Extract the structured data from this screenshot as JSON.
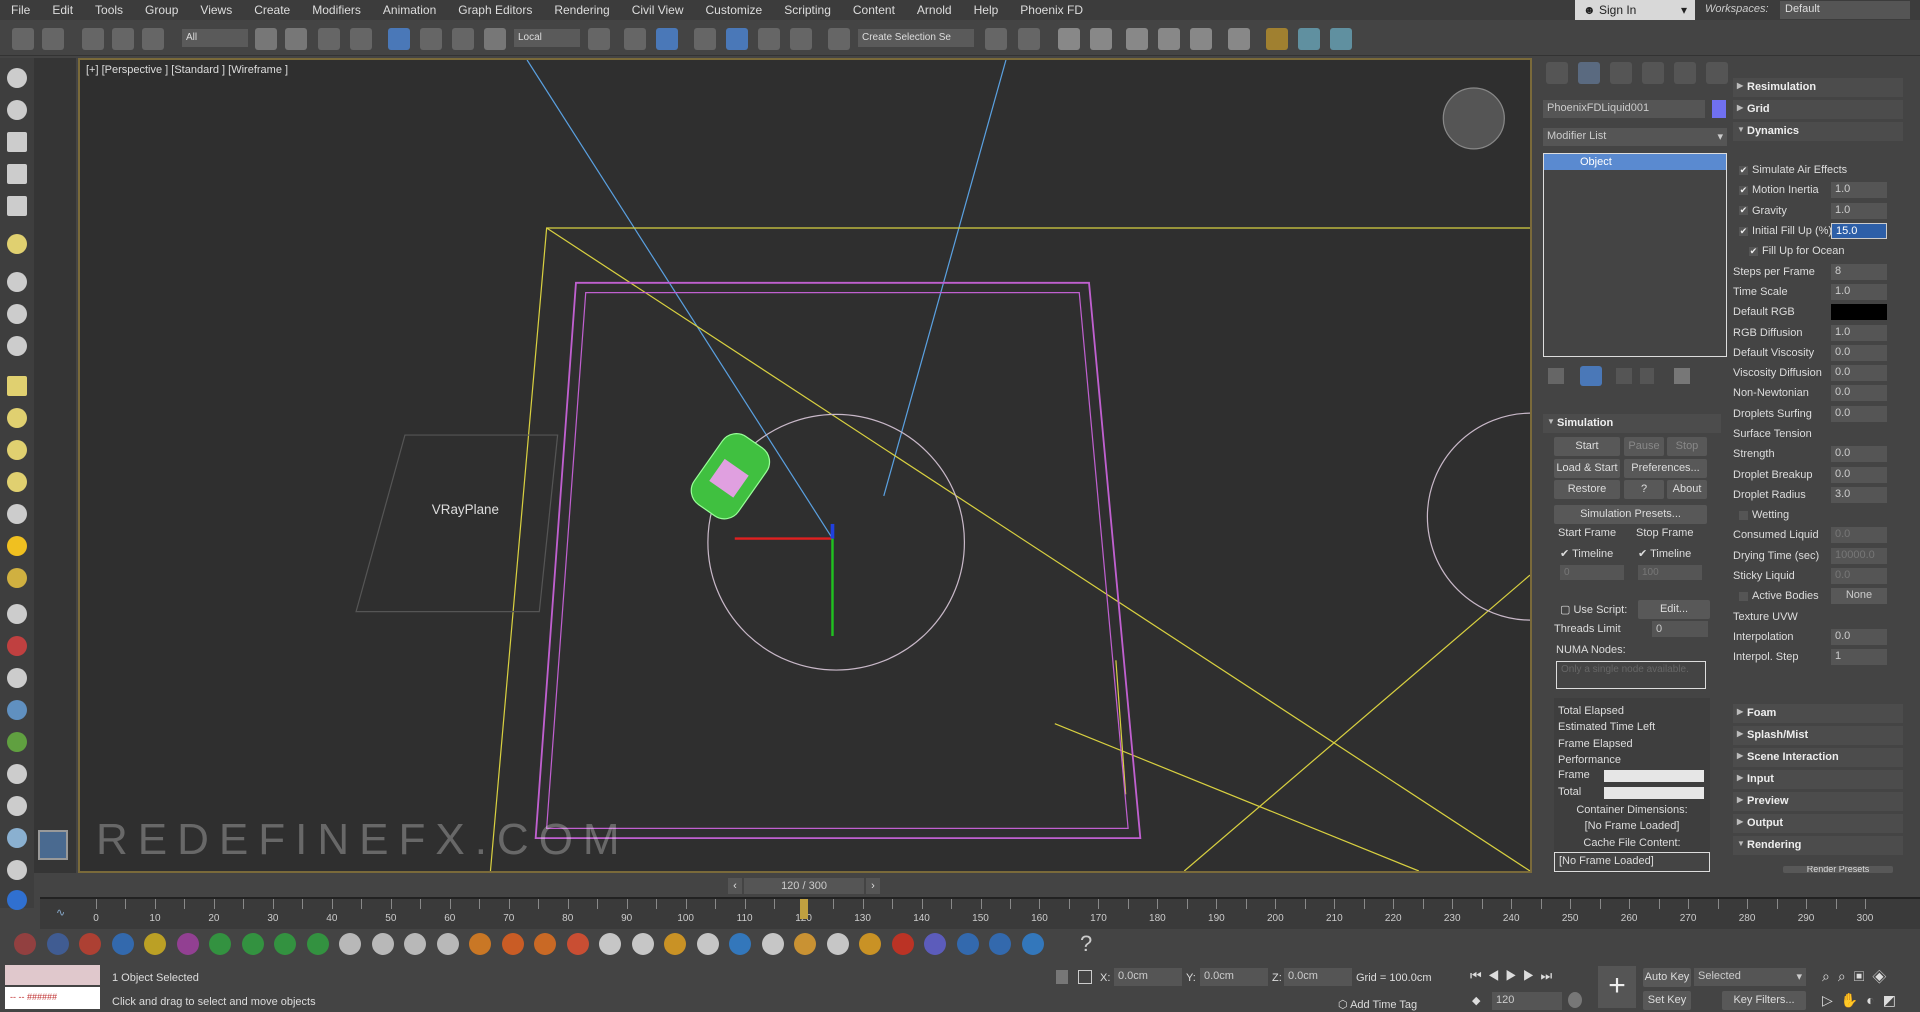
{
  "menu": [
    "File",
    "Edit",
    "Tools",
    "Group",
    "Views",
    "Create",
    "Modifiers",
    "Animation",
    "Graph Editors",
    "Rendering",
    "Civil View",
    "Customize",
    "Scripting",
    "Content",
    "Arnold",
    "Help",
    "Phoenix FD"
  ],
  "account": {
    "sign_in": "Sign In",
    "workspaces_label": "Workspaces:",
    "workspace": "Default"
  },
  "toolbar": {
    "selection_filter": "All",
    "coord_system": "Local",
    "named_selection": "Create Selection Se"
  },
  "viewport": {
    "label": "[+] [Perspective ] [Standard ] [Wireframe ]",
    "object_label": "VRayPlane",
    "watermark": "REDEFINEFX.COM",
    "colors": {
      "box": "#c060d0",
      "lines": "#d8d040",
      "camera": "#5aa0e0",
      "car": "#40c040"
    }
  },
  "command_panel": {
    "object_name": "PhoenixFDLiquid001",
    "object_color": "#7070f0",
    "modifier_list": "Modifier List",
    "stack_item": "Object",
    "simulation": {
      "title": "Simulation",
      "start": "Start",
      "pause": "Pause",
      "stop": "Stop",
      "load_start": "Load & Start",
      "preferences": "Preferences...",
      "restore": "Restore",
      "help": "?",
      "about": "About",
      "presets": "Simulation Presets...",
      "start_frame": "Start Frame",
      "stop_frame": "Stop Frame",
      "timeline": "Timeline",
      "start_value": "0",
      "stop_value": "100",
      "use_script": "Use Script:",
      "edit": "Edit...",
      "threads_label": "Threads Limit",
      "threads": "0",
      "numa": "NUMA Nodes:",
      "numa_placeholder": "Only a single node available.",
      "status": [
        "Total Elapsed",
        "Estimated Time Left",
        "Frame Elapsed",
        "Performance"
      ],
      "frame": "Frame",
      "total": "Total",
      "container_dims": "Container Dimensions:",
      "no_frame": "[No Frame Loaded]",
      "cache_content": "Cache File Content:",
      "cache_value": "[No Frame Loaded]"
    },
    "rollouts_top": [
      {
        "title": "Resimulation",
        "open": false
      },
      {
        "title": "Grid",
        "open": false
      },
      {
        "title": "Dynamics",
        "open": true
      }
    ],
    "dynamics": [
      {
        "label": "Simulate Air Effects",
        "check": true
      },
      {
        "label": "Motion Inertia",
        "check": true,
        "value": "1.0"
      },
      {
        "label": "Gravity",
        "check": true,
        "value": "1.0"
      },
      {
        "label": "Initial Fill Up (%)",
        "check": true,
        "value": "15.0",
        "selected": true
      },
      {
        "label": "Fill Up for Ocean",
        "check": true,
        "indent": true
      },
      {
        "label": "Steps per Frame",
        "value": "8"
      },
      {
        "label": "Time Scale",
        "value": "1.0"
      },
      {
        "label": "Default RGB",
        "value": "",
        "swatch": "#000000"
      },
      {
        "label": "RGB Diffusion",
        "value": "1.0"
      },
      {
        "label": "Default Viscosity",
        "value": "0.0"
      },
      {
        "label": "Viscosity Diffusion",
        "value": "0.0"
      },
      {
        "label": "Non-Newtonian",
        "value": "0.0"
      },
      {
        "label": "Droplets Surfing",
        "value": "0.0"
      },
      {
        "label": "Surface Tension"
      },
      {
        "label": "Strength",
        "value": "0.0"
      },
      {
        "label": "Droplet Breakup",
        "value": "0.0"
      },
      {
        "label": "Droplet Radius",
        "value": "3.0"
      },
      {
        "label": "Wetting",
        "check": false
      },
      {
        "label": "Consumed Liquid",
        "value": "0.0",
        "disabled": true
      },
      {
        "label": "Drying Time (sec)",
        "value": "10000.0",
        "disabled": true
      },
      {
        "label": "Sticky Liquid",
        "value": "0.0",
        "disabled": true
      },
      {
        "label": "Active Bodies",
        "check": false,
        "value": "None"
      },
      {
        "label": "Texture UVW"
      },
      {
        "label": "Interpolation",
        "value": "0.0"
      },
      {
        "label": "Interpol. Step",
        "value": "1"
      }
    ],
    "rollouts_bottom": [
      {
        "title": "Foam",
        "open": false
      },
      {
        "title": "Splash/Mist",
        "open": false
      },
      {
        "title": "Scene Interaction",
        "open": false
      },
      {
        "title": "Input",
        "open": false
      },
      {
        "title": "Preview",
        "open": false
      },
      {
        "title": "Output",
        "open": false
      },
      {
        "title": "Rendering",
        "open": true
      }
    ],
    "render_presets": "Render Presets"
  },
  "timeline": {
    "frame_display": "120 / 300",
    "current": 120,
    "start": 0,
    "end": 300
  },
  "bottom_toolbar_colors": [
    "#a04040",
    "#4060a0",
    "#c04030",
    "#3070c0",
    "#d0b020",
    "#a040a0",
    "#30a040",
    "#30a040",
    "#30a040",
    "#30a040",
    "#ccc",
    "#ccc",
    "#ccc",
    "#ccc",
    "#e08020",
    "#e06020",
    "#e07020",
    "#e05030",
    "#ddd",
    "#ddd",
    "#e0a020",
    "#ddd",
    "#3080d0",
    "#ddd",
    "#e0a030",
    "#ddd",
    "#e0a020",
    "#d03020",
    "#6060d0",
    "#3070c0",
    "#3070c0",
    "#3080d0"
  ],
  "status": {
    "selected": "1 Object Selected",
    "hint": "Click and drag to select and move objects",
    "x": "0.0cm",
    "y": "0.0cm",
    "z": "0.0cm",
    "grid": "Grid = 100.0cm",
    "add_time_tag": "Add Time Tag",
    "frame": "120",
    "auto_key": "Auto Key",
    "set_key": "Set Key",
    "key_mode": "Selected",
    "key_filters": "Key Filters..."
  }
}
